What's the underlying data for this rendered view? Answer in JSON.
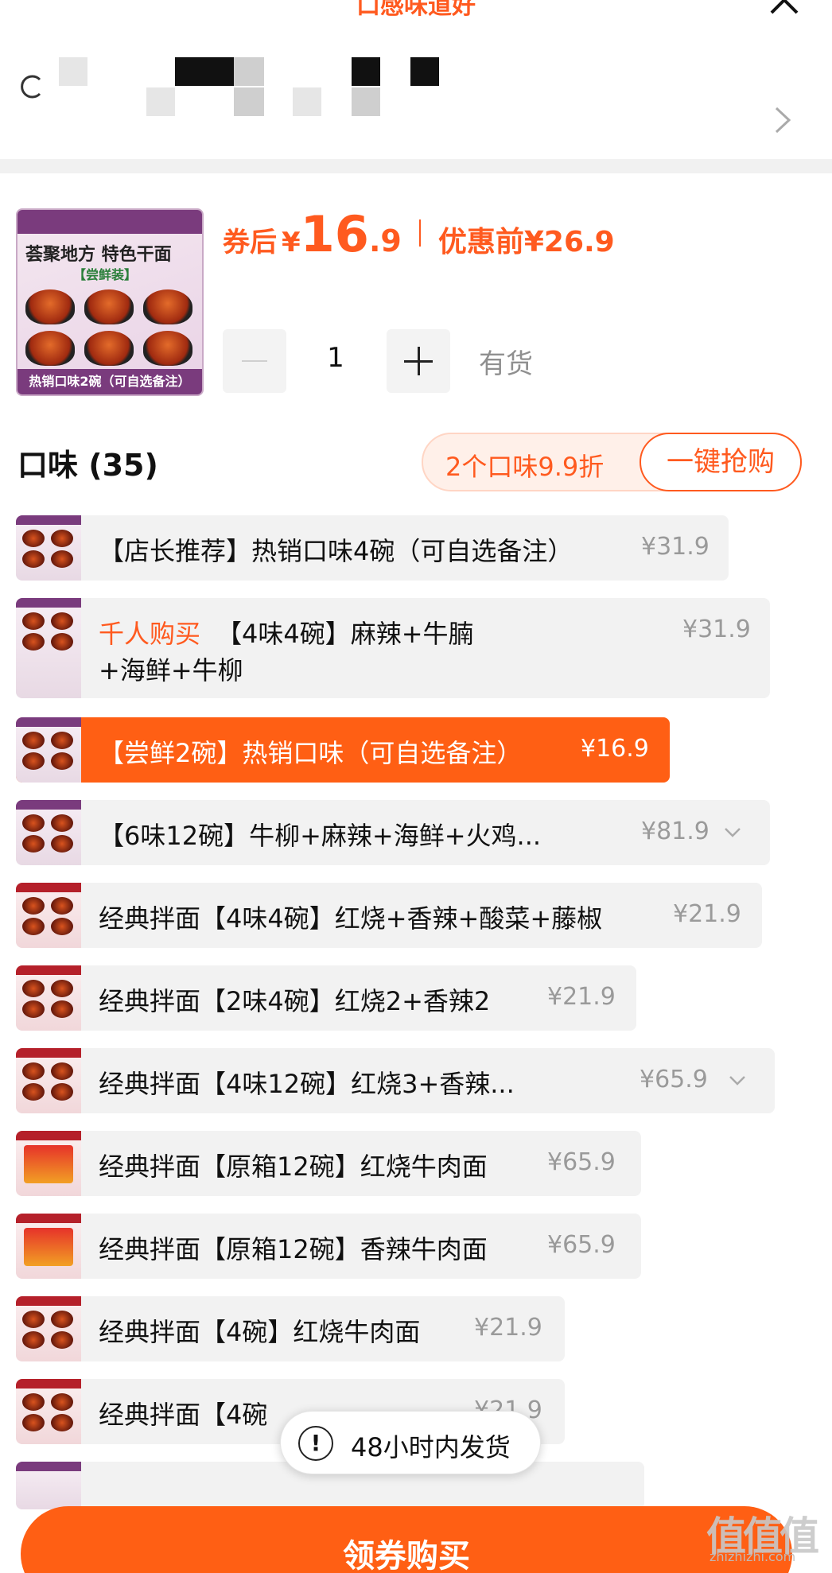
{
  "header": {
    "title": "口感味道好"
  },
  "product": {
    "thumb_title": "荟聚地方 特色干面",
    "thumb_sub": "【尝鲜装】",
    "thumb_bottom": "热销口味2碗（可自选备注）",
    "price_label": "券后",
    "currency": "¥",
    "price_int": "16",
    "price_dec": ".9",
    "orig_label": "优惠前",
    "orig_price": "¥26.9",
    "quantity": "1",
    "stock": "有货"
  },
  "flavors": {
    "heading": "口味 (35)",
    "promo_text": "2个口味9.9折",
    "promo_button": "一键抢购",
    "options": [
      {
        "text": "【店长推荐】热销口味4碗（可自选备注）",
        "price": "¥31.9"
      },
      {
        "highlight": "千人购买",
        "text": "【4味4碗】麻辣+牛腩",
        "text2": "+海鲜+牛柳",
        "price": "¥31.9"
      },
      {
        "text": "【尝鲜2碗】热销口味（可自选备注）",
        "price": "¥16.9"
      },
      {
        "text": "【6味12碗】牛柳+麻辣+海鲜+火鸡...",
        "price": "¥81.9"
      },
      {
        "text": "经典拌面【4味4碗】红烧+香辣+酸菜+藤椒",
        "price": "¥21.9"
      },
      {
        "text": "经典拌面【2味4碗】红烧2+香辣2",
        "price": "¥21.9"
      },
      {
        "text": "经典拌面【4味12碗】红烧3+香辣...",
        "price": "¥65.9"
      },
      {
        "text": "经典拌面【原箱12碗】红烧牛肉面",
        "price": "¥65.9"
      },
      {
        "text": "经典拌面【原箱12碗】香辣牛肉面",
        "price": "¥65.9"
      },
      {
        "text": "经典拌面【4碗】红烧牛肉面",
        "price": "¥21.9"
      },
      {
        "text": "经典拌面【4碗",
        "price": "¥21.9"
      }
    ]
  },
  "toast": {
    "text": "48小时内发货"
  },
  "buy": {
    "label": "领券购买"
  },
  "watermark": {
    "logo": "值值值",
    "site": "zhizhizhi.com"
  },
  "colors": {
    "accent": "#ff5f14",
    "option_bg": "#f2f2f2",
    "promo_bg": "#fff0e9"
  },
  "icons": [
    "close-icon",
    "location-icon",
    "chevron-right-icon",
    "minus-icon",
    "plus-icon",
    "chevron-down-icon",
    "alert-icon"
  ]
}
